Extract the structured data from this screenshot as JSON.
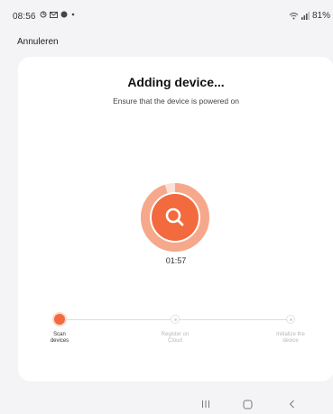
{
  "status_bar": {
    "time": "08:56",
    "battery": "81%",
    "left_icons": [
      "gallery-icon",
      "mail-icon",
      "messenger-icon",
      "notification-dot-icon"
    ],
    "right_icons": [
      "wifi-icon",
      "signal-icon"
    ]
  },
  "header": {
    "cancel_label": "Annuleren"
  },
  "main": {
    "title": "Adding device...",
    "subtitle": "Ensure that the device is powered on",
    "timer": "01:57",
    "accent_color": "#f26a3d",
    "scan_progress": 0.95
  },
  "steps": [
    {
      "label_line1": "Scan",
      "label_line2": "devices",
      "state": "active"
    },
    {
      "label_line1": "Register on",
      "label_line2": "Cloud",
      "state": "pending"
    },
    {
      "label_line1": "Initialize the",
      "label_line2": "device",
      "state": "pending"
    }
  ],
  "nav": {
    "buttons": [
      "recent-apps",
      "home",
      "back"
    ]
  }
}
